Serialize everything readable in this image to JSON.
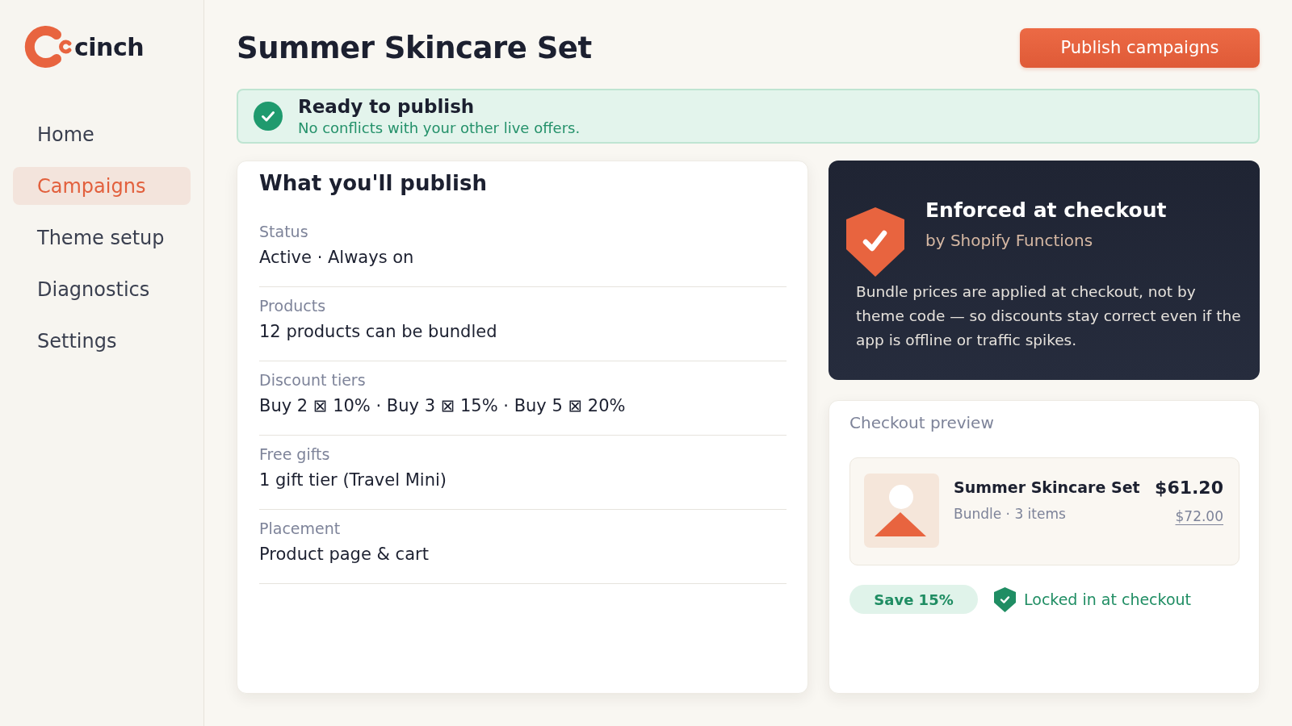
{
  "sidebar": {
    "logo": {
      "text": "cinch"
    },
    "items": [
      {
        "label": "Home",
        "selected": false
      },
      {
        "label": "Campaigns",
        "selected": true
      },
      {
        "label": "Theme setup",
        "selected": false
      },
      {
        "label": "Diagnostics",
        "selected": false
      },
      {
        "label": "Settings",
        "selected": false
      }
    ]
  },
  "header": {
    "title": "Summer Skincare Set",
    "primary_button": "Publish campaigns"
  },
  "banner": {
    "title": "Ready to publish",
    "message": "No conflicts with your other live offers."
  },
  "summary": {
    "title": "What you'll publish",
    "rows": [
      {
        "label": "Status",
        "value": "Active · Always on"
      },
      {
        "label": "Products",
        "value": "12 products can be bundled"
      },
      {
        "label": "Discount tiers",
        "value": "Buy 2 ⊠ 10% · Buy 3 ⊠ 15% · Buy 5 ⊠ 20%"
      },
      {
        "label": "Free gifts",
        "value": "1 gift tier (Travel Mini)"
      },
      {
        "label": "Placement",
        "value": "Product page & cart"
      }
    ]
  },
  "enforcement_card": {
    "title": "Enforced at checkout",
    "subtitle": "by Shopify Functions",
    "body": "Bundle prices are applied at checkout, not by theme code — so discounts stay correct even if the app is offline or traffic spikes."
  },
  "checkout_preview": {
    "title": "Checkout preview",
    "item": {
      "name": "Summer Skincare Set",
      "meta": "Bundle · 3 items",
      "price": "$61.20",
      "original_price": "$72.00"
    },
    "savings_badge": "Save 15%",
    "lock_note": "Locked in at checkout"
  }
}
